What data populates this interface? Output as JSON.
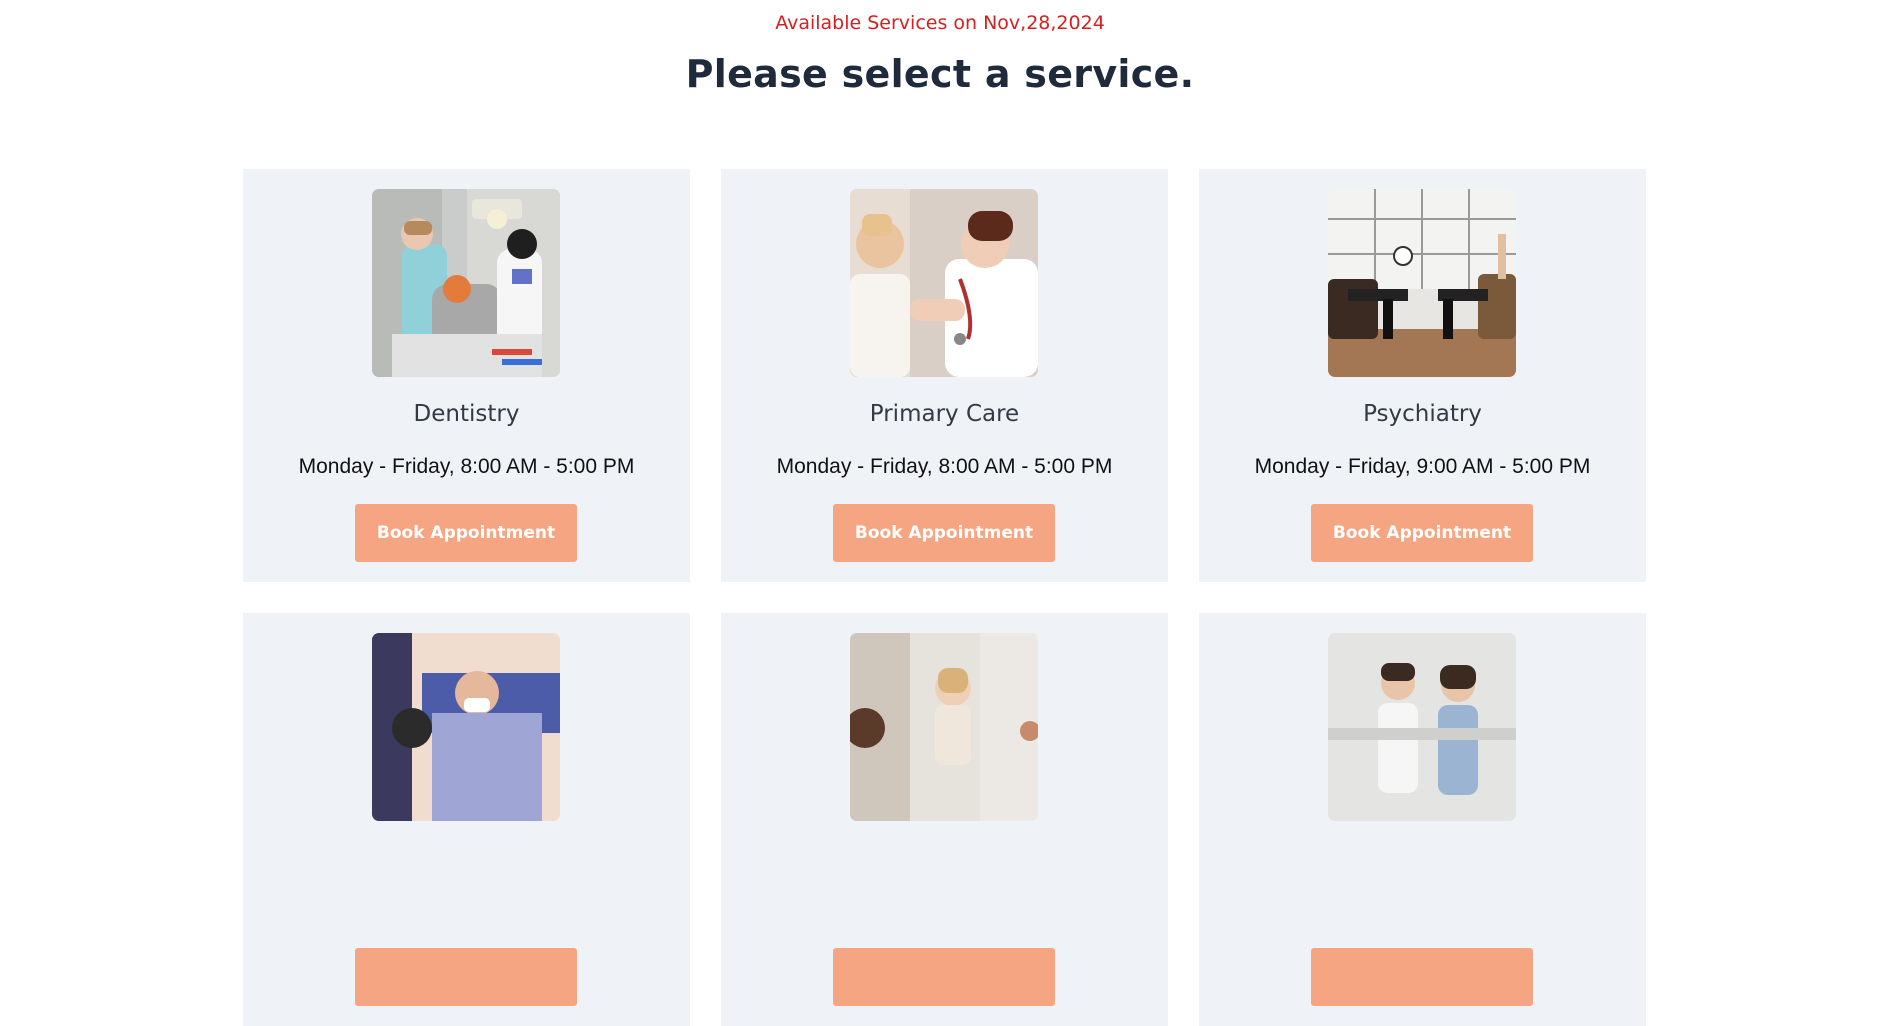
{
  "header": {
    "date_line": "Available Services on Nov,28,2024",
    "title": "Please select a service."
  },
  "services": [
    {
      "name": "Dentistry",
      "hours": "Monday - Friday, 8:00 AM - 5:00 PM",
      "button": "Book Appointment"
    },
    {
      "name": "Primary Care",
      "hours": "Monday - Friday, 8:00 AM - 5:00 PM",
      "button": "Book Appointment"
    },
    {
      "name": "Psychiatry",
      "hours": "Monday - Friday, 9:00 AM - 5:00 PM",
      "button": "Book Appointment"
    },
    {
      "name": "",
      "hours": "",
      "button": ""
    },
    {
      "name": "",
      "hours": "",
      "button": ""
    },
    {
      "name": "",
      "hours": "",
      "button": ""
    }
  ],
  "colors": {
    "date_line": "#d61f1f",
    "title": "#1f2a3c",
    "card_background": "#eff3f8",
    "button": "#f5a582"
  }
}
